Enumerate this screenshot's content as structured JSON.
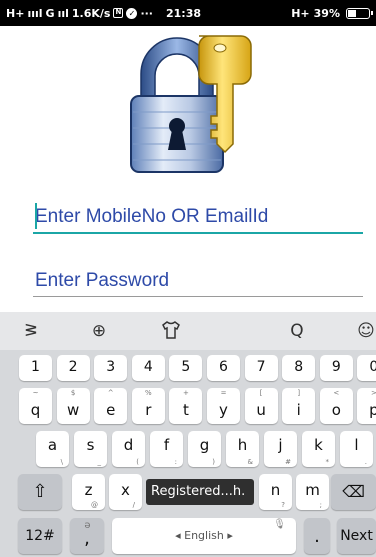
{
  "status_bar": {
    "signal1": "H+",
    "signal1_bars": "ıııl",
    "signal2": "G",
    "signal2_bars": "ııl",
    "speed": "1.6K/s",
    "notif_icon": "N",
    "check_icon": "✓",
    "dots": "···",
    "time": "21:38",
    "signal3": "H+",
    "battery": "39%",
    "battery_level": 0.39
  },
  "logo": {
    "icon": "lock-and-key-logo"
  },
  "login": {
    "mobile_placeholder": "Enter MobileNo OR EmailId",
    "password_placeholder": "Enter Password"
  },
  "colors": {
    "accent_teal": "#1ba6a6",
    "underline_gray": "#9a9a9a",
    "placeholder_blue": "#2e4aa8"
  },
  "keyboard": {
    "toolbar": {
      "icons": [
        "gesture-icon",
        "globe-icon",
        "theme-shirt-icon",
        "search-icon",
        "emoji-icon"
      ],
      "glyphs": [
        "ᕒ",
        "⊕",
        "👕",
        "Q",
        "☺"
      ]
    },
    "number_row": [
      "1",
      "2",
      "3",
      "4",
      "5",
      "6",
      "7",
      "8",
      "9",
      "0"
    ],
    "row1": [
      {
        "key": "q",
        "sub": "~"
      },
      {
        "key": "w",
        "sub": "$"
      },
      {
        "key": "e",
        "sub": "^"
      },
      {
        "key": "r",
        "sub": "%"
      },
      {
        "key": "t",
        "sub": "+"
      },
      {
        "key": "y",
        "sub": "="
      },
      {
        "key": "u",
        "sub": "["
      },
      {
        "key": "i",
        "sub": "]"
      },
      {
        "key": "o",
        "sub": "<"
      },
      {
        "key": "p",
        "sub": ">"
      }
    ],
    "row2": [
      {
        "key": "a",
        "sub": "\\"
      },
      {
        "key": "s",
        "sub": "_"
      },
      {
        "key": "d",
        "sub": "("
      },
      {
        "key": "f",
        "sub": ":"
      },
      {
        "key": "g",
        "sub": ")"
      },
      {
        "key": "h",
        "sub": "&"
      },
      {
        "key": "j",
        "sub": "#"
      },
      {
        "key": "k",
        "sub": "*"
      },
      {
        "key": "l",
        "sub": "."
      }
    ],
    "row3": [
      {
        "key": "z",
        "sub": "@"
      },
      {
        "key": "x",
        "sub": "/"
      },
      {
        "key": "n",
        "sub": "?"
      },
      {
        "key": "m",
        "sub": ";"
      }
    ],
    "shift": "⇧",
    "backspace": "⌫",
    "tooltip": "Registered...h.",
    "bottom_row": {
      "symbols": "12#",
      "comma": ",",
      "comma_sub": "ə",
      "space": "◂ English ▸",
      "mic": "🎙",
      "period": ".",
      "next": "Next"
    }
  }
}
